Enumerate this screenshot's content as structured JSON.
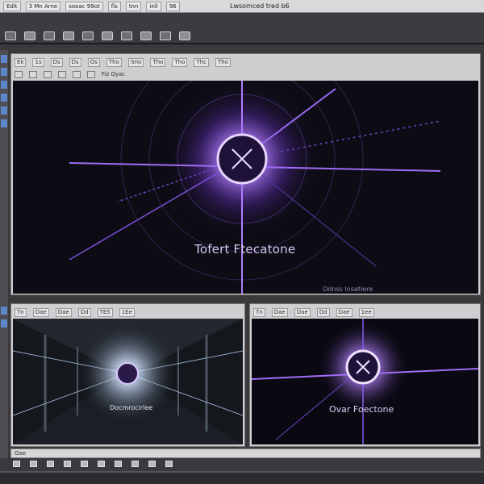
{
  "app": {
    "title": "Lwsomced tred b6",
    "menu": [
      "Edit",
      "3 Mn Arne",
      "sooac 99ot",
      "fls",
      "tnn",
      "inll",
      "96"
    ]
  },
  "main_panel": {
    "tabs": [
      "Ek",
      "1s",
      "Ds",
      "Ds",
      "Os",
      "Tho",
      "Srio",
      "Tho",
      "Tho",
      "Thc",
      "Tho"
    ],
    "sub_label": "Fiz Oyac",
    "headline": "Tofert Ftecatone",
    "subline": "Odnss Insatiere"
  },
  "panel_a": {
    "tabs": [
      "Tn",
      "Dae",
      "Dae",
      "Dd",
      "TE5",
      "1Ee"
    ],
    "caption": "Docmrocirlee"
  },
  "panel_b": {
    "tabs": [
      "Tn",
      "Dae",
      "Dae",
      "Dd",
      "Dae",
      "1ee"
    ],
    "caption": "Ovar Foectone"
  },
  "timeline": {
    "label": "Oae"
  },
  "colors": {
    "accent": "#8a5cf0",
    "glow": "#b685ff",
    "viewer_bg": "#0d0c14"
  }
}
